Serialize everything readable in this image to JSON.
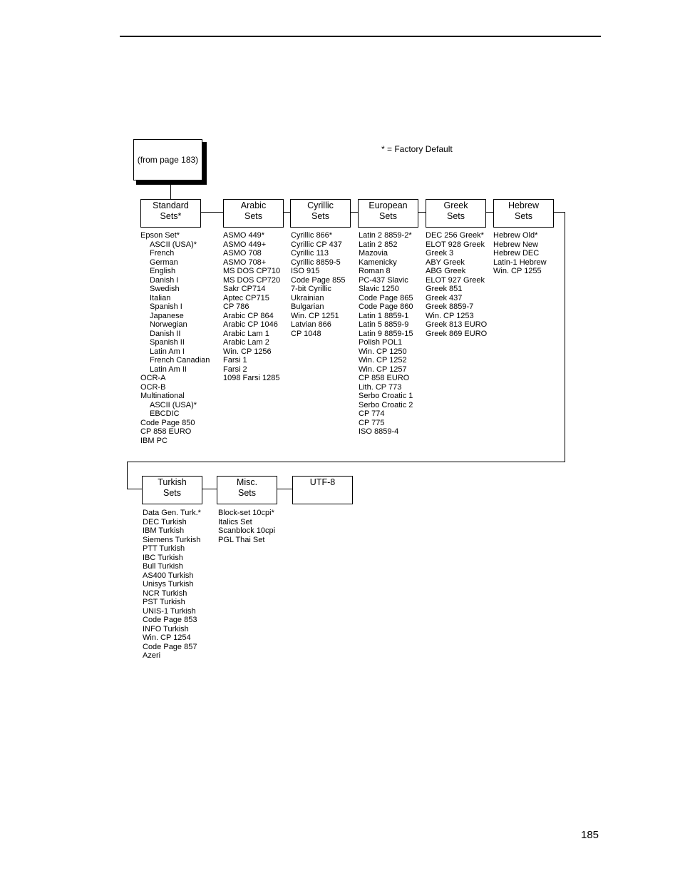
{
  "header_rule": true,
  "entry": {
    "label": "(from page 183)"
  },
  "legend": "* = Factory Default",
  "page_number": "185",
  "groups": [
    {
      "title": [
        "Standard",
        "Sets*"
      ],
      "items": [
        {
          "t": "Epson Set*"
        },
        {
          "t": "ASCII (USA)*",
          "indent": true
        },
        {
          "t": "French",
          "indent": true
        },
        {
          "t": "German",
          "indent": true
        },
        {
          "t": "English",
          "indent": true
        },
        {
          "t": "Danish I",
          "indent": true
        },
        {
          "t": "Swedish",
          "indent": true
        },
        {
          "t": "Italian",
          "indent": true
        },
        {
          "t": "Spanish I",
          "indent": true
        },
        {
          "t": "Japanese",
          "indent": true
        },
        {
          "t": "Norwegian",
          "indent": true
        },
        {
          "t": "Danish II",
          "indent": true
        },
        {
          "t": "Spanish II",
          "indent": true
        },
        {
          "t": "Latin Am I",
          "indent": true
        },
        {
          "t": "French Canadian",
          "indent": true
        },
        {
          "t": "Latin Am II",
          "indent": true
        },
        {
          "t": "OCR-A"
        },
        {
          "t": "OCR-B"
        },
        {
          "t": "Multinational"
        },
        {
          "t": "ASCII (USA)*",
          "indent": true
        },
        {
          "t": "EBCDIC",
          "indent": true
        },
        {
          "t": "Code Page 850"
        },
        {
          "t": "CP 858 EURO"
        },
        {
          "t": "IBM PC"
        }
      ]
    },
    {
      "title": [
        "Arabic",
        "Sets"
      ],
      "items": [
        {
          "t": "ASMO 449*"
        },
        {
          "t": "ASMO 449+"
        },
        {
          "t": "ASMO 708"
        },
        {
          "t": "ASMO 708+"
        },
        {
          "t": "MS DOS CP710"
        },
        {
          "t": "MS DOS CP720"
        },
        {
          "t": "Sakr CP714"
        },
        {
          "t": "Aptec CP715"
        },
        {
          "t": "CP 786"
        },
        {
          "t": "Arabic CP 864"
        },
        {
          "t": "Arabic CP 1046"
        },
        {
          "t": "Arabic Lam 1"
        },
        {
          "t": "Arabic Lam 2"
        },
        {
          "t": "Win. CP 1256"
        },
        {
          "t": "Farsi 1"
        },
        {
          "t": "Farsi 2"
        },
        {
          "t": "1098 Farsi 1285"
        }
      ]
    },
    {
      "title": [
        "Cyrillic",
        "Sets"
      ],
      "items": [
        {
          "t": "Cyrillic 866*"
        },
        {
          "t": "Cyrillic CP 437"
        },
        {
          "t": "Cyrillic 113"
        },
        {
          "t": "Cyrillic 8859-5"
        },
        {
          "t": "ISO 915"
        },
        {
          "t": "Code Page 855"
        },
        {
          "t": "7-bit Cyrillic"
        },
        {
          "t": "Ukrainian"
        },
        {
          "t": "Bulgarian"
        },
        {
          "t": "Win. CP 1251"
        },
        {
          "t": "Latvian 866"
        },
        {
          "t": "CP 1048"
        }
      ]
    },
    {
      "title": [
        "European",
        "Sets"
      ],
      "items": [
        {
          "t": "Latin 2 8859-2*"
        },
        {
          "t": "Latin 2 852"
        },
        {
          "t": "Mazovia"
        },
        {
          "t": "Kamenicky"
        },
        {
          "t": "Roman 8"
        },
        {
          "t": "PC-437 Slavic"
        },
        {
          "t": "Slavic 1250"
        },
        {
          "t": "Code Page 865"
        },
        {
          "t": "Code Page 860"
        },
        {
          "t": "Latin 1 8859-1"
        },
        {
          "t": "Latin 5 8859-9"
        },
        {
          "t": "Latin 9 8859-15"
        },
        {
          "t": "Polish POL1"
        },
        {
          "t": "Win. CP 1250"
        },
        {
          "t": "Win. CP 1252"
        },
        {
          "t": "Win. CP 1257"
        },
        {
          "t": "CP 858 EURO"
        },
        {
          "t": "Lith. CP 773"
        },
        {
          "t": "Serbo Croatic 1"
        },
        {
          "t": "Serbo Croatic 2"
        },
        {
          "t": "CP 774"
        },
        {
          "t": "CP 775"
        },
        {
          "t": "ISO 8859-4"
        }
      ]
    },
    {
      "title": [
        "Greek",
        "Sets"
      ],
      "items": [
        {
          "t": "DEC 256 Greek*"
        },
        {
          "t": "ELOT 928 Greek"
        },
        {
          "t": "Greek 3"
        },
        {
          "t": "ABY Greek"
        },
        {
          "t": "ABG Greek"
        },
        {
          "t": "ELOT 927 Greek"
        },
        {
          "t": "Greek 851"
        },
        {
          "t": "Greek 437"
        },
        {
          "t": "Greek 8859-7"
        },
        {
          "t": "Win. CP 1253"
        },
        {
          "t": "Greek 813 EURO"
        },
        {
          "t": "Greek 869 EURO"
        }
      ]
    },
    {
      "title": [
        "Hebrew",
        "Sets"
      ],
      "items": [
        {
          "t": "Hebrew Old*"
        },
        {
          "t": "Hebrew New"
        },
        {
          "t": "Hebrew DEC"
        },
        {
          "t": "Latin-1 Hebrew"
        },
        {
          "t": "Win. CP 1255"
        }
      ]
    },
    {
      "title": [
        "Turkish",
        "Sets"
      ],
      "items": [
        {
          "t": "Data Gen. Turk.*"
        },
        {
          "t": "DEC Turkish"
        },
        {
          "t": "IBM Turkish"
        },
        {
          "t": "Siemens Turkish"
        },
        {
          "t": "PTT Turkish"
        },
        {
          "t": "IBC Turkish"
        },
        {
          "t": "Bull Turkish"
        },
        {
          "t": "AS400 Turkish"
        },
        {
          "t": "Unisys Turkish"
        },
        {
          "t": "NCR Turkish"
        },
        {
          "t": "PST Turkish"
        },
        {
          "t": "UNIS-1 Turkish"
        },
        {
          "t": "Code Page 853"
        },
        {
          "t": "INFO Turkish"
        },
        {
          "t": "Win. CP 1254"
        },
        {
          "t": "Code Page 857"
        },
        {
          "t": "Azeri"
        }
      ]
    },
    {
      "title": [
        "Misc.",
        "Sets"
      ],
      "items": [
        {
          "t": "Block-set 10cpi*"
        },
        {
          "t": "Italics Set"
        },
        {
          "t": "Scanblock 10cpi"
        },
        {
          "t": "PGL Thai Set"
        }
      ]
    },
    {
      "title": [
        "UTF-8"
      ],
      "items": []
    }
  ]
}
